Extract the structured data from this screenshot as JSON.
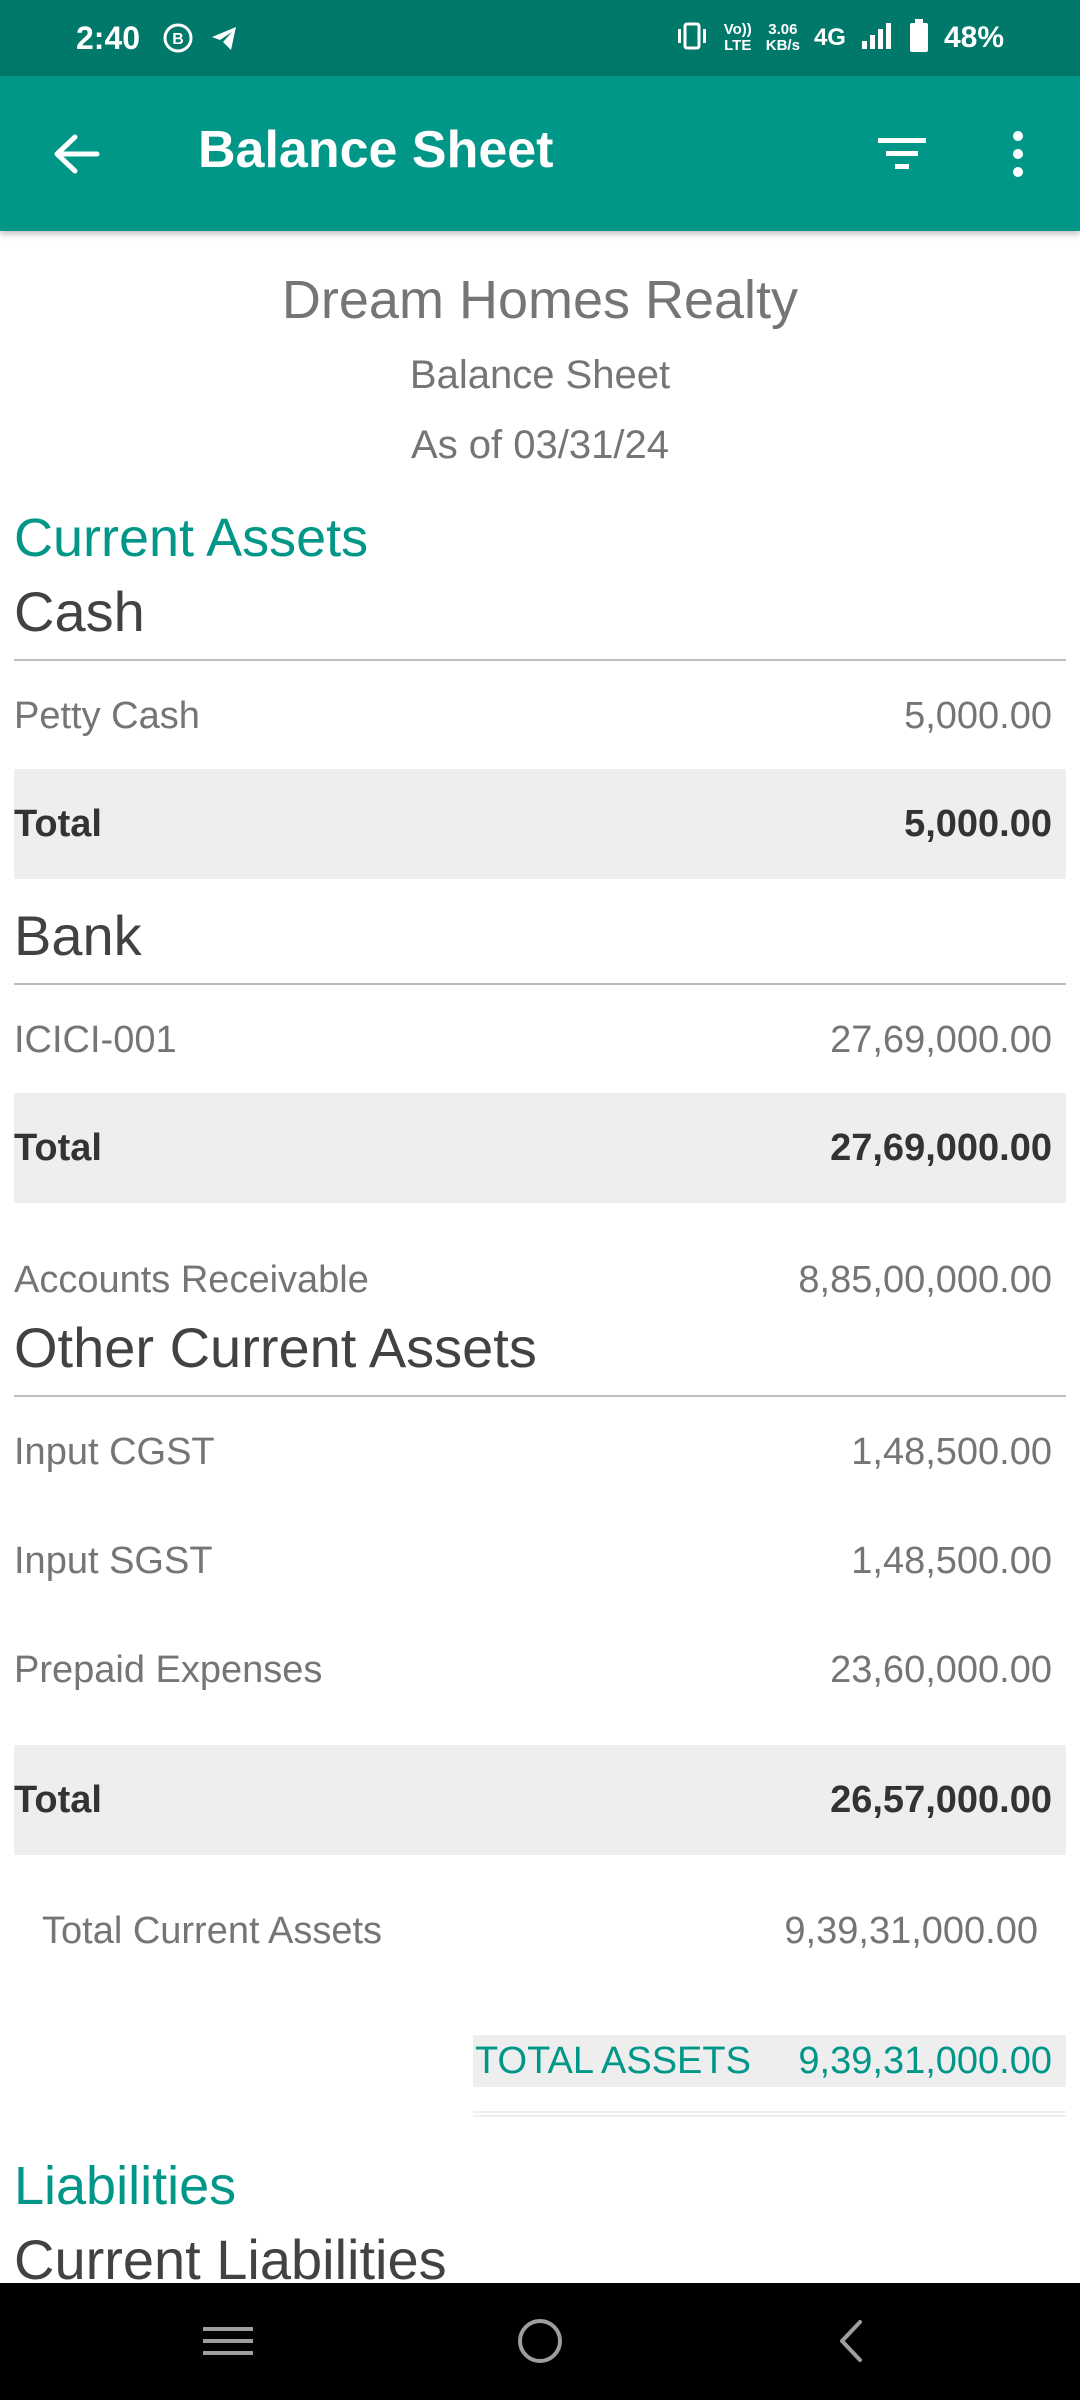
{
  "status_bar": {
    "time": "2:40",
    "net_speed_top": "3.06",
    "net_speed_bottom": "KB/s",
    "volte_top": "Vo))",
    "volte_bottom": "LTE",
    "network": "4G",
    "battery": "48%"
  },
  "app_bar": {
    "title": "Balance Sheet"
  },
  "header": {
    "company": "Dream Homes Realty",
    "report": "Balance Sheet",
    "as_of": "As of 03/31/24"
  },
  "current_assets": {
    "title": "Current Assets",
    "cash": {
      "title": "Cash",
      "rows": [
        {
          "label": "Petty Cash",
          "amount": "5,000.00"
        }
      ],
      "total_label": "Total",
      "total": "5,000.00"
    },
    "bank": {
      "title": "Bank",
      "rows": [
        {
          "label": "ICICI-001",
          "amount": "27,69,000.00"
        }
      ],
      "total_label": "Total",
      "total": "27,69,000.00"
    },
    "accounts_receivable": {
      "label": "Accounts Receivable",
      "amount": "8,85,00,000.00"
    },
    "other": {
      "title": "Other Current Assets",
      "rows": [
        {
          "label": "Input CGST",
          "amount": "1,48,500.00"
        },
        {
          "label": "Input SGST",
          "amount": "1,48,500.00"
        },
        {
          "label": "Prepaid Expenses",
          "amount": "23,60,000.00"
        }
      ],
      "total_label": "Total",
      "total": "26,57,000.00"
    },
    "total_current_assets": {
      "label": "Total Current Assets",
      "amount": "9,39,31,000.00"
    }
  },
  "total_assets": {
    "label": "TOTAL ASSETS",
    "amount": "9,39,31,000.00"
  },
  "liabilities": {
    "title": "Liabilities",
    "current_title": "Current Liabilities"
  },
  "icons": {
    "status": [
      "b-circle-icon",
      "telegram-icon",
      "vibrate-icon",
      "signal-icon",
      "battery-icon"
    ],
    "app_bar": [
      "back-arrow-icon",
      "filter-icon",
      "more-vert-icon"
    ],
    "nav": [
      "recents-icon",
      "home-icon",
      "back-icon"
    ]
  },
  "colors": {
    "status_bar": "#00796b",
    "app_bar": "#009688",
    "accent": "#009688",
    "total_row_bg": "#eeeeee"
  }
}
